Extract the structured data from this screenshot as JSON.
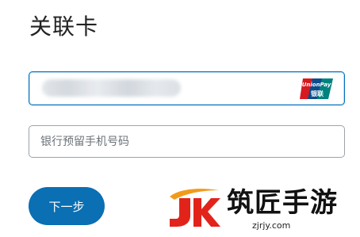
{
  "page": {
    "title": "关联卡"
  },
  "card_field": {
    "masked_value": "",
    "brand_logo": "unionpay-logo",
    "brand_text_top": "UnionPay",
    "brand_text_bottom": "银联"
  },
  "phone_field": {
    "placeholder": "银行预留手机号码",
    "value": ""
  },
  "actions": {
    "next_label": "下一步"
  },
  "watermark": {
    "name": "筑匠手游",
    "url": "zjrjy.com"
  },
  "colors": {
    "accent": "#0070ba",
    "button": "#0a6fb3",
    "border": "#9aa3ab",
    "unionpay_red": "#d71920",
    "unionpay_blue": "#0b4d8c",
    "unionpay_teal": "#00827f"
  }
}
